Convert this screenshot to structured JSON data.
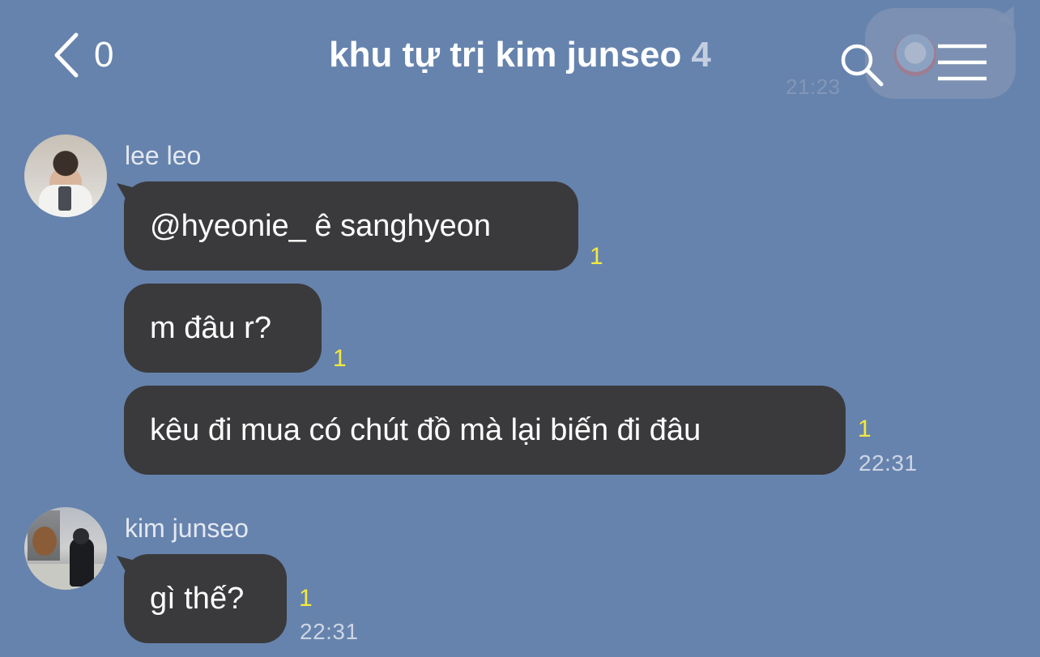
{
  "header": {
    "back_count": "0",
    "title": "khu tự trị kim junseo",
    "member_count": "4",
    "search_icon": "search-icon",
    "menu_icon": "hamburger-menu-icon",
    "back_icon": "chevron-left-icon"
  },
  "background_previous": {
    "timestamp": "21:23",
    "emoji": "clown-face-emoji"
  },
  "messages": [
    {
      "sender": "lee leo",
      "items": [
        {
          "text": "@hyeonie_ ê sanghyeon",
          "unread": "1"
        },
        {
          "text": "m đâu r?",
          "unread": "1"
        },
        {
          "text": "kêu đi mua có chút đồ mà lại biến đi đâu",
          "unread": "1",
          "time": "22:31"
        }
      ]
    },
    {
      "sender": "kim junseo",
      "items": [
        {
          "text": "gì thế?",
          "unread": "1",
          "time": "22:31"
        }
      ]
    }
  ],
  "colors": {
    "background": "#6683ad",
    "bubble": "#3a3a3c",
    "unread": "#f5ea3c"
  }
}
